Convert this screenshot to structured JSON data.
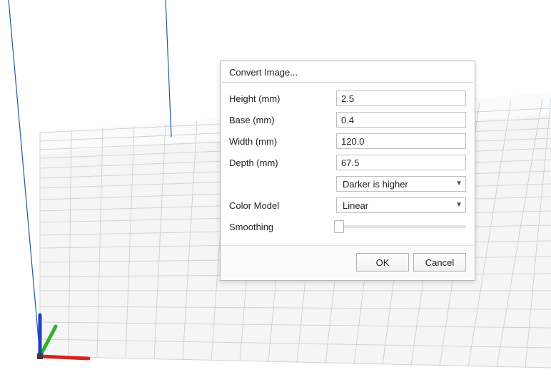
{
  "dialog": {
    "title": "Convert Image...",
    "fields": {
      "height": {
        "label": "Height (mm)",
        "value": "2.5"
      },
      "base": {
        "label": "Base (mm)",
        "value": "0.4"
      },
      "width": {
        "label": "Width (mm)",
        "value": "120.0"
      },
      "depth": {
        "label": "Depth (mm)",
        "value": "67.5"
      }
    },
    "height_map_mode": {
      "label": "",
      "selected": "Darker is higher"
    },
    "color_model": {
      "label": "Color Model",
      "selected": "Linear"
    },
    "smoothing": {
      "label": "Smoothing",
      "value": 0
    },
    "buttons": {
      "ok": "OK",
      "cancel": "Cancel"
    }
  }
}
